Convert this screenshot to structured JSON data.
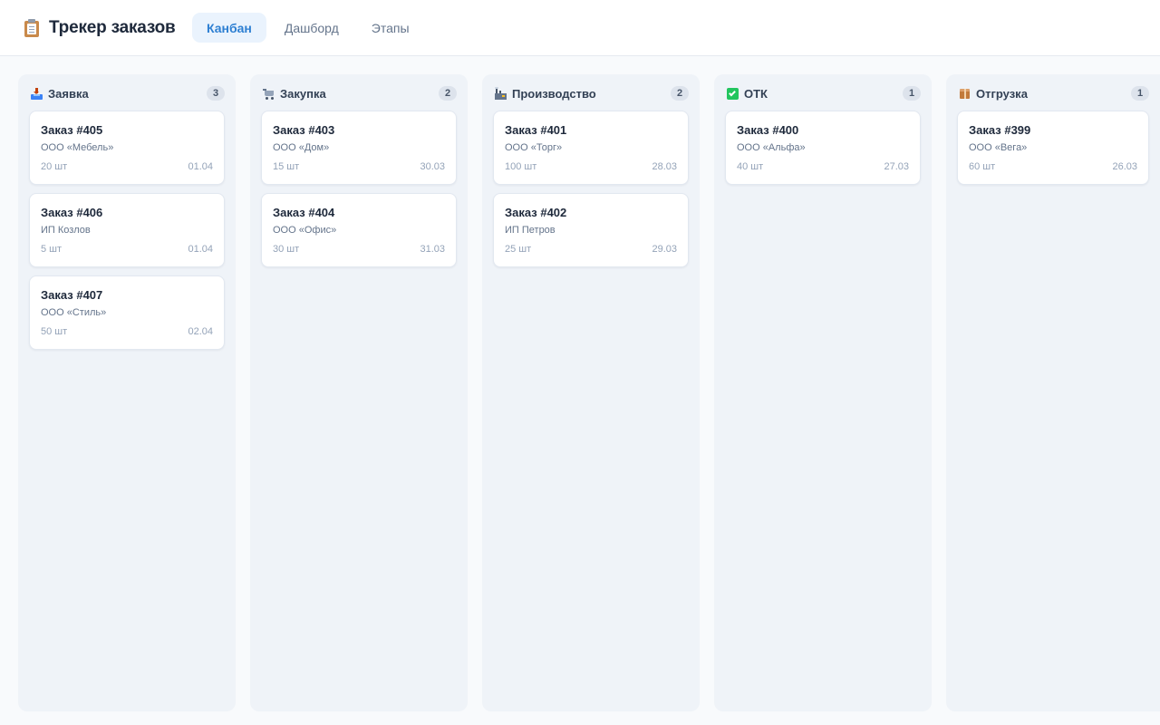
{
  "app": {
    "title": "Трекер заказов",
    "icon": "clipboard-icon"
  },
  "tabs": [
    {
      "label": "Канбан",
      "active": true
    },
    {
      "label": "Дашборд",
      "active": false
    },
    {
      "label": "Этапы",
      "active": false
    }
  ],
  "colors": {
    "accent": "#2d7fd2",
    "tab_active_bg": "#eaf3fd",
    "column_bg": "#eff3f8",
    "card_bg": "#ffffff"
  },
  "columns": [
    {
      "name": "Заявка",
      "icon": "inbox-tray-icon",
      "count": "3",
      "cards": [
        {
          "title": "Заказ #405",
          "client": "ООО «Мебель»",
          "qty": "20 шт",
          "date": "01.04"
        },
        {
          "title": "Заказ #406",
          "client": "ИП Козлов",
          "qty": "5 шт",
          "date": "01.04"
        },
        {
          "title": "Заказ #407",
          "client": "ООО «Стиль»",
          "qty": "50 шт",
          "date": "02.04"
        }
      ]
    },
    {
      "name": "Закупка",
      "icon": "shopping-cart-icon",
      "count": "2",
      "cards": [
        {
          "title": "Заказ #403",
          "client": "ООО «Дом»",
          "qty": "15 шт",
          "date": "30.03"
        },
        {
          "title": "Заказ #404",
          "client": "ООО «Офис»",
          "qty": "30 шт",
          "date": "31.03"
        }
      ]
    },
    {
      "name": "Производство",
      "icon": "factory-icon",
      "count": "2",
      "cards": [
        {
          "title": "Заказ #401",
          "client": "ООО «Торг»",
          "qty": "100 шт",
          "date": "28.03"
        },
        {
          "title": "Заказ #402",
          "client": "ИП Петров",
          "qty": "25 шт",
          "date": "29.03"
        }
      ]
    },
    {
      "name": "ОТК",
      "icon": "check-mark-icon",
      "count": "1",
      "cards": [
        {
          "title": "Заказ #400",
          "client": "ООО «Альфа»",
          "qty": "40 шт",
          "date": "27.03"
        }
      ]
    },
    {
      "name": "Отгрузка",
      "icon": "package-icon",
      "count": "1",
      "cards": [
        {
          "title": "Заказ #399",
          "client": "ООО «Вега»",
          "qty": "60 шт",
          "date": "26.03"
        }
      ]
    }
  ]
}
